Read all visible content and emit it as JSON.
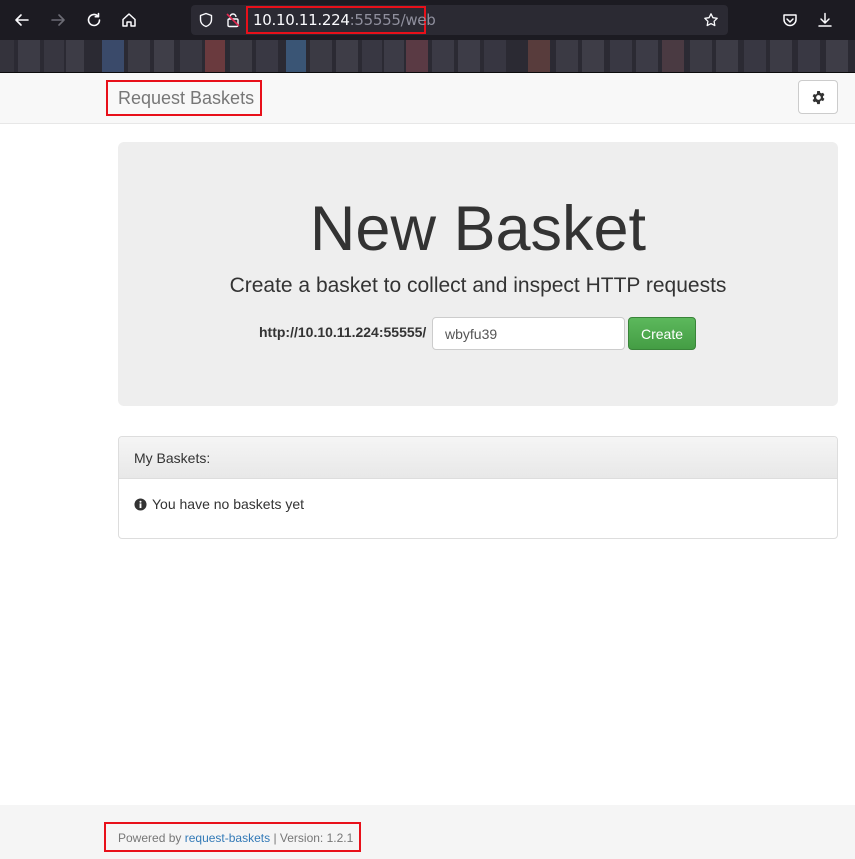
{
  "browser": {
    "url_host": "10.10.11.224",
    "url_rest": ":55555/web",
    "icons": [
      "back-arrow-icon",
      "forward-arrow-icon",
      "reload-icon",
      "home-icon",
      "shield-icon",
      "lock-icon",
      "star-icon",
      "pocket-icon",
      "download-icon"
    ]
  },
  "navbar": {
    "brand": "Request Baskets",
    "settings_icon": "gear-icon"
  },
  "jumbotron": {
    "title": "New Basket",
    "subtitle": "Create a basket to collect and inspect HTTP requests",
    "url_prefix": "http://10.10.11.224:55555/",
    "basket_name_value": "wbyfu39",
    "create_label": "Create"
  },
  "baskets_panel": {
    "title": "My Baskets:",
    "empty_message": "You have no baskets yet",
    "info_icon": "info-circle-icon"
  },
  "footer": {
    "powered_by": "Powered by",
    "link": "request-baskets",
    "version_text": "| Version: 1.2.1"
  },
  "colors": {
    "annotation_red": "#e8101a",
    "create_green": "#5cb85c",
    "link_blue": "#337ab7"
  }
}
